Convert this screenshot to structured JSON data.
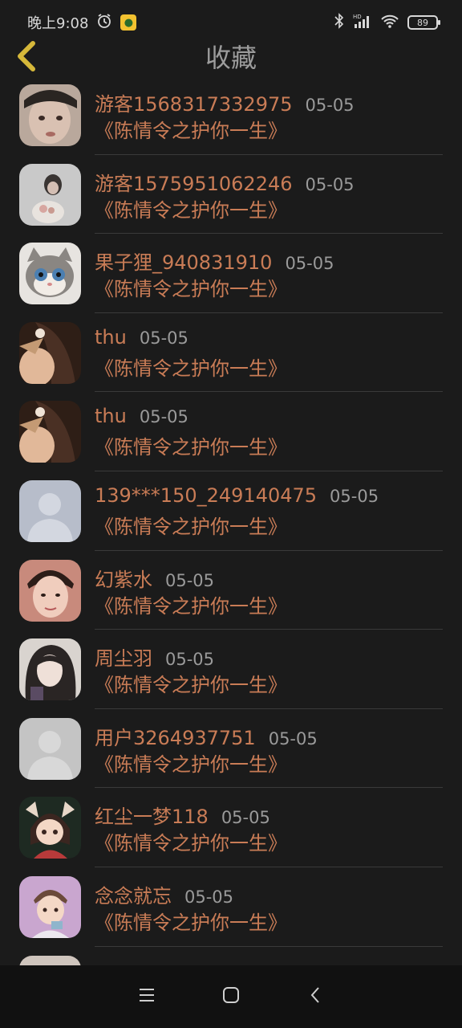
{
  "status_bar": {
    "time": "晚上9:08",
    "battery": "89",
    "icons": [
      "alarm-icon",
      "app-notification-icon",
      "bluetooth-icon",
      "hd-signal-icon",
      "wifi-icon",
      "battery-icon"
    ]
  },
  "header": {
    "title": "收藏",
    "back_icon": "chevron-left-icon"
  },
  "items": [
    {
      "name": "游客1568317332975",
      "date": "05-05",
      "title": "《陈情令之护你一生》",
      "avatar": "photo-face"
    },
    {
      "name": "游客1575951062246",
      "date": "05-05",
      "title": "《陈情令之护你一生》",
      "avatar": "photo-girl-flowers"
    },
    {
      "name": "果子狸_940831910",
      "date": "05-05",
      "title": "《陈情令之护你一生》",
      "avatar": "kitten"
    },
    {
      "name": "thu",
      "date": "05-05",
      "title": "《陈情令之护你一生》",
      "avatar": "illustration-hair"
    },
    {
      "name": "thu",
      "date": "05-05",
      "title": "《陈情令之护你一生》",
      "avatar": "illustration-hair"
    },
    {
      "name": "139***150_249140475",
      "date": "05-05",
      "title": "《陈情令之护你一生》",
      "avatar": "default-person"
    },
    {
      "name": "幻紫水",
      "date": "05-05",
      "title": "《陈情令之护你一生》",
      "avatar": "photo-boy"
    },
    {
      "name": "周尘羽",
      "date": "05-05",
      "title": "《陈情令之护你一生》",
      "avatar": "anime-dark"
    },
    {
      "name": "用户3264937751",
      "date": "05-05",
      "title": "《陈情令之护你一生》",
      "avatar": "default-person-gray"
    },
    {
      "name": "红尘一梦118",
      "date": "05-05",
      "title": "《陈情令之护你一生》",
      "avatar": "chibi-girl"
    },
    {
      "name": "念念就忘",
      "date": "05-05",
      "title": "《陈情令之护你一生》",
      "avatar": "cartoon-boy"
    },
    {
      "name": "",
      "date": "",
      "title": "",
      "avatar": "partial"
    }
  ],
  "nav_bar": {
    "icons": [
      "menu-icon",
      "home-icon",
      "back-icon"
    ]
  },
  "colors": {
    "background": "#1b1b1b",
    "accent_text": "#c97c56",
    "date_text": "#9a9a9a",
    "title_text": "#9c9c9c",
    "back_arrow": "#d6b83a"
  }
}
